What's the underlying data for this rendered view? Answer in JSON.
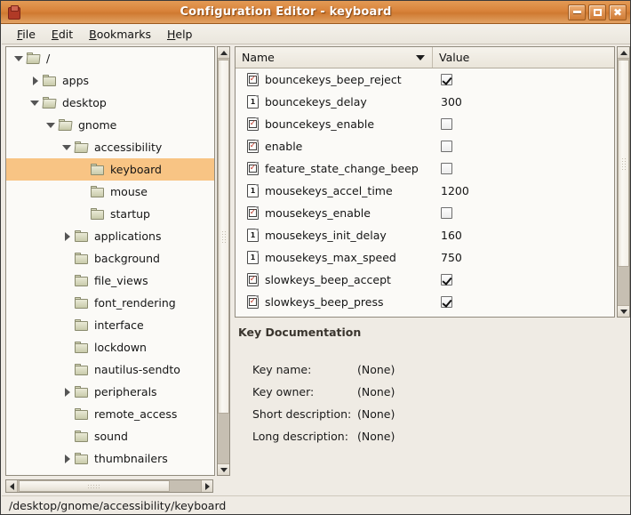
{
  "window": {
    "title": "Configuration Editor - keyboard",
    "app_icon": "chair-icon",
    "controls": [
      {
        "name": "minimize-button",
        "glyph": "minimize-icon"
      },
      {
        "name": "maximize-button",
        "glyph": "maximize-icon"
      },
      {
        "name": "close-button",
        "glyph": "close-icon",
        "label": "✖"
      }
    ]
  },
  "menubar": {
    "items": [
      {
        "mnemonic": "F",
        "rest": "ile"
      },
      {
        "mnemonic": "E",
        "rest": "dit"
      },
      {
        "mnemonic": "B",
        "rest": "ookmarks"
      },
      {
        "mnemonic": "H",
        "rest": "elp"
      }
    ]
  },
  "tree": {
    "rows": [
      {
        "label": "/",
        "depth": 0,
        "expander": "open",
        "folder": "open",
        "selected": false
      },
      {
        "label": "apps",
        "depth": 1,
        "expander": "closed",
        "folder": "closed",
        "selected": false
      },
      {
        "label": "desktop",
        "depth": 1,
        "expander": "open",
        "folder": "open",
        "selected": false
      },
      {
        "label": "gnome",
        "depth": 2,
        "expander": "open",
        "folder": "open",
        "selected": false
      },
      {
        "label": "accessibility",
        "depth": 3,
        "expander": "open",
        "folder": "open",
        "selected": false
      },
      {
        "label": "keyboard",
        "depth": 4,
        "expander": "none",
        "folder": "closed",
        "selected": true
      },
      {
        "label": "mouse",
        "depth": 4,
        "expander": "none",
        "folder": "closed",
        "selected": false
      },
      {
        "label": "startup",
        "depth": 4,
        "expander": "none",
        "folder": "closed",
        "selected": false
      },
      {
        "label": "applications",
        "depth": 3,
        "expander": "closed",
        "folder": "closed",
        "selected": false
      },
      {
        "label": "background",
        "depth": 3,
        "expander": "none",
        "folder": "closed",
        "selected": false
      },
      {
        "label": "file_views",
        "depth": 3,
        "expander": "none",
        "folder": "closed",
        "selected": false
      },
      {
        "label": "font_rendering",
        "depth": 3,
        "expander": "none",
        "folder": "closed",
        "selected": false
      },
      {
        "label": "interface",
        "depth": 3,
        "expander": "none",
        "folder": "closed",
        "selected": false
      },
      {
        "label": "lockdown",
        "depth": 3,
        "expander": "none",
        "folder": "closed",
        "selected": false
      },
      {
        "label": "nautilus-sendto",
        "depth": 3,
        "expander": "none",
        "folder": "closed",
        "selected": false
      },
      {
        "label": "peripherals",
        "depth": 3,
        "expander": "closed",
        "folder": "closed",
        "selected": false
      },
      {
        "label": "remote_access",
        "depth": 3,
        "expander": "none",
        "folder": "closed",
        "selected": false
      },
      {
        "label": "sound",
        "depth": 3,
        "expander": "none",
        "folder": "closed",
        "selected": false
      },
      {
        "label": "thumbnailers",
        "depth": 3,
        "expander": "closed",
        "folder": "closed",
        "selected": false
      },
      {
        "label": "",
        "depth": 3,
        "expander": "none",
        "folder": "closed",
        "selected": false
      }
    ]
  },
  "list": {
    "columns": {
      "name": "Name",
      "value": "Value"
    },
    "sort_indicator": "chevron-down-icon",
    "rows": [
      {
        "key": "bouncekeys_beep_reject",
        "type": "bool",
        "value": true
      },
      {
        "key": "bouncekeys_delay",
        "type": "int",
        "value": "300"
      },
      {
        "key": "bouncekeys_enable",
        "type": "bool",
        "value": false
      },
      {
        "key": "enable",
        "type": "bool",
        "value": false
      },
      {
        "key": "feature_state_change_beep",
        "type": "bool",
        "value": false
      },
      {
        "key": "mousekeys_accel_time",
        "type": "int",
        "value": "1200"
      },
      {
        "key": "mousekeys_enable",
        "type": "bool",
        "value": false
      },
      {
        "key": "mousekeys_init_delay",
        "type": "int",
        "value": "160"
      },
      {
        "key": "mousekeys_max_speed",
        "type": "int",
        "value": "750"
      },
      {
        "key": "slowkeys_beep_accept",
        "type": "bool",
        "value": true
      },
      {
        "key": "slowkeys_beep_press",
        "type": "bool",
        "value": true
      }
    ]
  },
  "documentation": {
    "title": "Key Documentation",
    "fields": [
      {
        "label": "Key name:",
        "value": "(None)"
      },
      {
        "label": "Key owner:",
        "value": "(None)"
      },
      {
        "label": "Short description:",
        "value": "(None)"
      },
      {
        "label": "Long description:",
        "value": "(None)"
      }
    ]
  },
  "statusbar": {
    "path": "/desktop/gnome/accessibility/keyboard"
  },
  "colors": {
    "titlebar": "#d8833a",
    "selection": "#f8c484",
    "window_bg": "#efebe4",
    "list_bg": "#fbfaf7"
  }
}
